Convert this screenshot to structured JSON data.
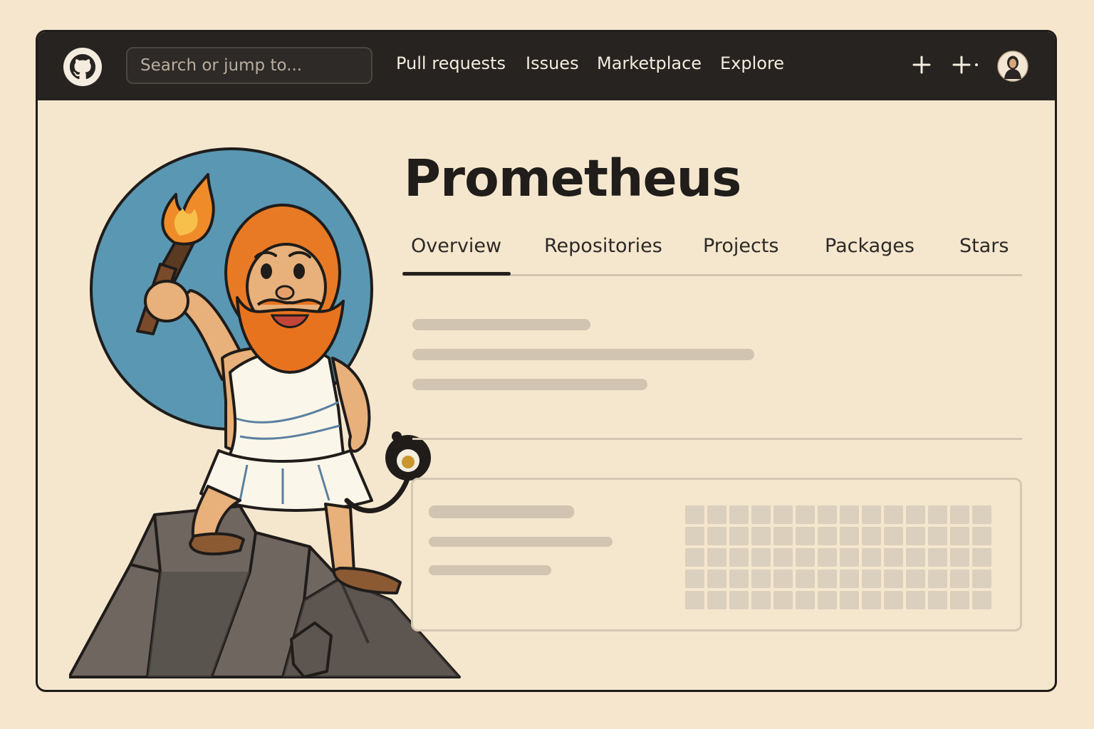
{
  "header": {
    "search_placeholder": "Search or jump to...",
    "nav": [
      "Pull requests",
      "Issues",
      "Marketplace",
      "Explore"
    ]
  },
  "profile": {
    "name": "Prometheus",
    "tabs": [
      "Overview",
      "Repositories",
      "Projects",
      "Packages",
      "Stars"
    ],
    "active_tab": "Overview"
  },
  "contribution_grid": {
    "rows": 5,
    "columns": 14
  },
  "colors": {
    "topbar": "#262320",
    "page_bg": "#f5e7ce",
    "skeleton": "#d1c4b1",
    "accent_blue": "#5a97b2",
    "beard_orange": "#e8731f"
  },
  "icons": [
    "github-logo-icon",
    "plus-icon",
    "plus-dropdown-icon",
    "avatar"
  ]
}
